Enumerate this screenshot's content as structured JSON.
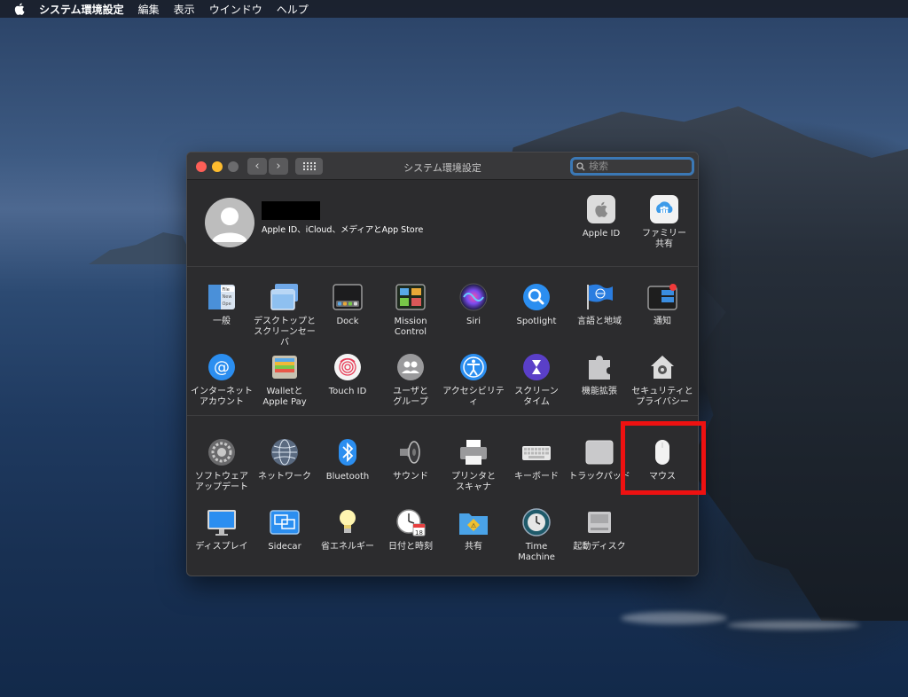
{
  "menubar": {
    "app": "システム環境設定",
    "items": [
      "編集",
      "表示",
      "ウインドウ",
      "ヘルプ"
    ]
  },
  "window": {
    "title": "システム環境設定",
    "search_placeholder": "検索"
  },
  "account": {
    "description": "Apple ID、iCloud、メディアとApp Store",
    "panes": [
      {
        "label": "Apple ID",
        "icon": "apple-id-icon"
      },
      {
        "label": "ファミリー\n共有",
        "icon": "family-sharing-icon"
      }
    ]
  },
  "section1": [
    {
      "label": "一般",
      "icon": "general-icon"
    },
    {
      "label": "デスクトップと\nスクリーンセーバ",
      "icon": "desktop-screensaver-icon"
    },
    {
      "label": "Dock",
      "icon": "dock-icon"
    },
    {
      "label": "Mission\nControl",
      "icon": "mission-control-icon"
    },
    {
      "label": "Siri",
      "icon": "siri-icon"
    },
    {
      "label": "Spotlight",
      "icon": "spotlight-icon"
    },
    {
      "label": "言語と地域",
      "icon": "language-region-icon"
    },
    {
      "label": "通知",
      "icon": "notifications-icon"
    },
    {
      "label": "インターネット\nアカウント",
      "icon": "internet-accounts-icon"
    },
    {
      "label": "Walletと\nApple Pay",
      "icon": "wallet-icon"
    },
    {
      "label": "Touch ID",
      "icon": "touch-id-icon"
    },
    {
      "label": "ユーザと\nグループ",
      "icon": "users-groups-icon"
    },
    {
      "label": "アクセシビリティ",
      "icon": "accessibility-icon"
    },
    {
      "label": "スクリーン\nタイム",
      "icon": "screen-time-icon"
    },
    {
      "label": "機能拡張",
      "icon": "extensions-icon"
    },
    {
      "label": "セキュリティと\nプライバシー",
      "icon": "security-privacy-icon"
    }
  ],
  "section2": [
    {
      "label": "ソフトウェア\nアップデート",
      "icon": "software-update-icon"
    },
    {
      "label": "ネットワーク",
      "icon": "network-icon"
    },
    {
      "label": "Bluetooth",
      "icon": "bluetooth-icon"
    },
    {
      "label": "サウンド",
      "icon": "sound-icon"
    },
    {
      "label": "プリンタと\nスキャナ",
      "icon": "printers-scanners-icon"
    },
    {
      "label": "キーボード",
      "icon": "keyboard-icon"
    },
    {
      "label": "トラックパッド",
      "icon": "trackpad-icon"
    },
    {
      "label": "マウス",
      "icon": "mouse-icon"
    },
    {
      "label": "ディスプレイ",
      "icon": "displays-icon"
    },
    {
      "label": "Sidecar",
      "icon": "sidecar-icon"
    },
    {
      "label": "省エネルギー",
      "icon": "energy-saver-icon"
    },
    {
      "label": "日付と時刻",
      "icon": "date-time-icon"
    },
    {
      "label": "共有",
      "icon": "sharing-icon"
    },
    {
      "label": "Time\nMachine",
      "icon": "time-machine-icon"
    },
    {
      "label": "起動ディスク",
      "icon": "startup-disk-icon"
    }
  ],
  "colors": {
    "highlight": "#ee1111",
    "search_focus": "#3b78b5",
    "window_bg": "#2c2c2e"
  }
}
